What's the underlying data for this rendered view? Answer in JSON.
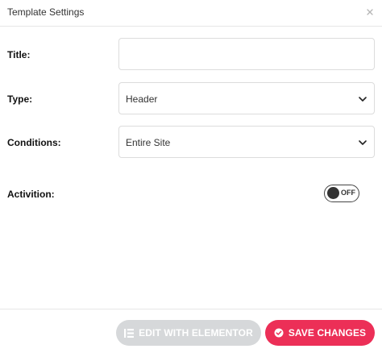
{
  "dialog": {
    "title": "Template Settings"
  },
  "fields": {
    "title": {
      "label": "Title:",
      "value": "",
      "placeholder": ""
    },
    "type": {
      "label": "Type:",
      "value": "Header"
    },
    "conditions": {
      "label": "Conditions:",
      "value": "Entire Site"
    },
    "activation": {
      "label": "Activition:",
      "state_text": "OFF",
      "enabled": false
    }
  },
  "footer": {
    "edit_label": "EDIT WITH ELEMENTOR",
    "save_label": "SAVE CHANGES"
  },
  "colors": {
    "save_button": "#ec2f57",
    "edit_button": "#d6d8da",
    "toggle_knob": "#333333"
  },
  "icons": {
    "close": "close-icon",
    "chevron": "chevron-down-icon",
    "elementor": "elementor-icon",
    "check": "check-circle-icon"
  }
}
